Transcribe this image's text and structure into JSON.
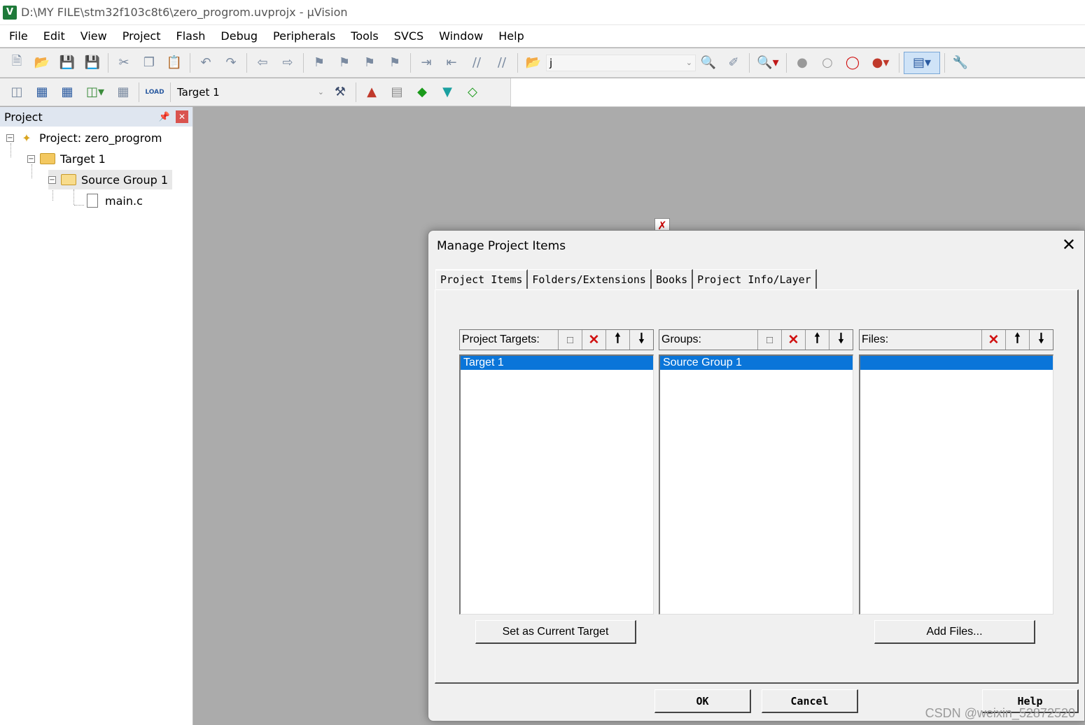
{
  "window": {
    "app_icon": "V",
    "title": "D:\\MY FILE\\stm32f103c8t6\\zero_progrom.uvprojx - µVision"
  },
  "menu": [
    "File",
    "Edit",
    "View",
    "Project",
    "Flash",
    "Debug",
    "Peripherals",
    "Tools",
    "SVCS",
    "Window",
    "Help"
  ],
  "toolbar": {
    "find_combo_value": "j",
    "target_combo_value": "Target 1",
    "load_label": "LOAD"
  },
  "project_panel": {
    "title": "Project",
    "tree": {
      "project": "Project: zero_progrom",
      "target": "Target 1",
      "group": "Source Group 1",
      "file": "main.c"
    }
  },
  "dialog": {
    "title": "Manage Project Items",
    "tabs": [
      "Project Items",
      "Folders/Extensions",
      "Books",
      "Project Info/Layer"
    ],
    "active_tab": "Project Items",
    "targets": {
      "label": "Project Targets:",
      "items": [
        "Target 1"
      ]
    },
    "groups": {
      "label": "Groups:",
      "items": [
        "Source Group 1"
      ]
    },
    "files": {
      "label": "Files:",
      "items": []
    },
    "buttons": {
      "set_current_target": "Set as Current Target",
      "add_files": "Add Files...",
      "ok": "OK",
      "cancel": "Cancel",
      "help": "Help"
    }
  },
  "watermark": "CSDN @weixin_52872520",
  "colors": {
    "selection": "#0a75d9",
    "background": "#ababab",
    "delete_icon": "#d01010"
  }
}
